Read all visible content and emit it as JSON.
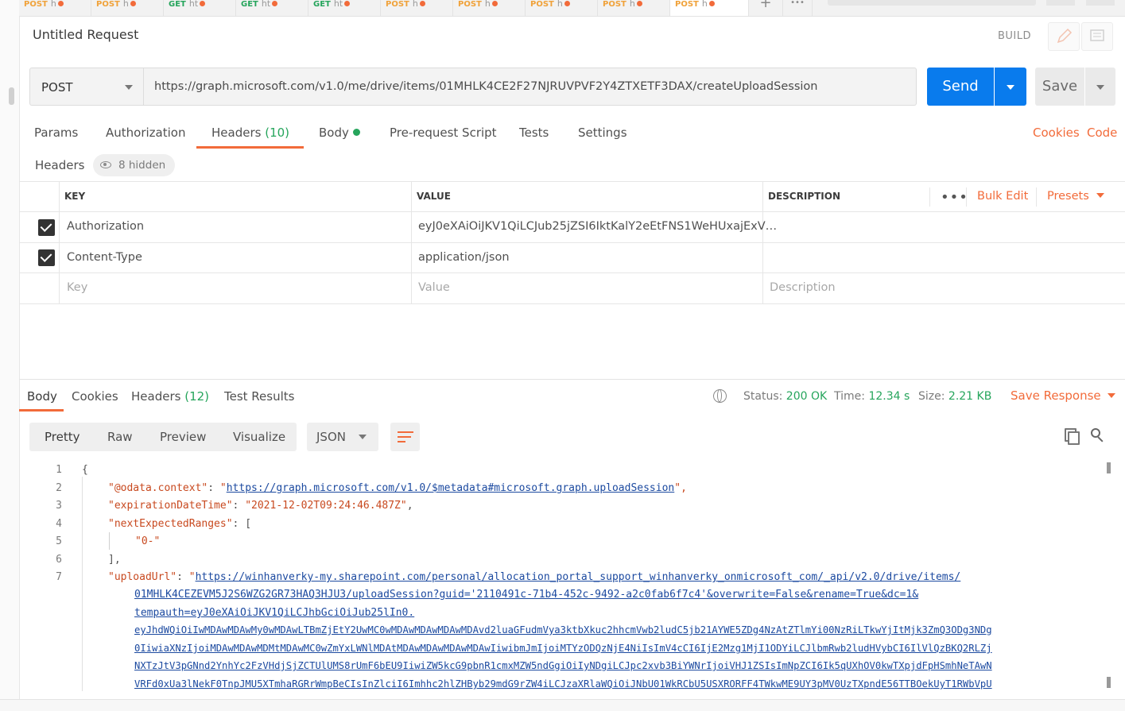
{
  "tabs": [
    {
      "method": "POST",
      "title": "h",
      "color": "#f0a23a"
    },
    {
      "method": "POST",
      "title": "h",
      "color": "#f0a23a"
    },
    {
      "method": "GET",
      "title": "ht",
      "color": "#26a55c"
    },
    {
      "method": "GET",
      "title": "ht",
      "color": "#26a55c"
    },
    {
      "method": "GET",
      "title": "ht",
      "color": "#26a55c"
    },
    {
      "method": "POST",
      "title": "h",
      "color": "#f0a23a"
    },
    {
      "method": "POST",
      "title": "h",
      "color": "#f0a23a"
    },
    {
      "method": "POST",
      "title": "h",
      "color": "#f0a23a"
    },
    {
      "method": "POST",
      "title": "h",
      "color": "#f0a23a"
    },
    {
      "method": "POST",
      "title": "h",
      "color": "#f0a23a"
    }
  ],
  "request": {
    "title": "Untitled Request",
    "build_label": "BUILD",
    "method": "POST",
    "url": "https://graph.microsoft.com/v1.0/me/drive/items/01MHLK4CE2F27NJRUVPVF2Y4ZTXETF3DAX/createUploadSession",
    "send_label": "Send",
    "save_label": "Save"
  },
  "request_tabs": {
    "params": "Params",
    "authorization": "Authorization",
    "headers": "Headers",
    "headers_count": "(10)",
    "body": "Body",
    "prerequest": "Pre-request Script",
    "tests": "Tests",
    "settings": "Settings",
    "cookies": "Cookies",
    "code": "Code"
  },
  "headers_section": {
    "label": "Headers",
    "hidden": "8 hidden",
    "col_key": "KEY",
    "col_value": "VALUE",
    "col_description": "DESCRIPTION",
    "more": "•••",
    "bulk_edit": "Bulk Edit",
    "presets": "Presets",
    "rows": [
      {
        "key": "Authorization",
        "value": "eyJ0eXAiOiJKV1QiLCJub25jZSI6IktKalY2eEtFNS1WeHUxajExV…"
      },
      {
        "key": "Content-Type",
        "value": "application/json"
      }
    ],
    "placeholder_key": "Key",
    "placeholder_value": "Value",
    "placeholder_description": "Description"
  },
  "response": {
    "tab_body": "Body",
    "tab_cookies": "Cookies",
    "tab_headers": "Headers",
    "headers_count": "(12)",
    "tab_tests": "Test Results",
    "status_label": "Status:",
    "status_value": "200 OK",
    "time_label": "Time:",
    "time_value": "12.34 s",
    "size_label": "Size:",
    "size_value": "2.21 KB",
    "save_response": "Save Response"
  },
  "view": {
    "pretty": "Pretty",
    "raw": "Raw",
    "preview": "Preview",
    "visualize": "Visualize",
    "format": "JSON"
  },
  "code": {
    "line_numbers": [
      "1",
      "2",
      "3",
      "4",
      "5",
      "6",
      "7"
    ],
    "l1": "{",
    "l2_key": "\"@odata.context\"",
    "l2_colon": ": ",
    "l2_q1": "\"",
    "l2_url": "https://graph.microsoft.com/v1.0/$metadata#microsoft.graph.uploadSession",
    "l2_end": "\",",
    "l3_key": "\"expirationDateTime\"",
    "l3_val": "\"2021-12-02T09:24:46.487Z\"",
    "l4_key": "\"nextExpectedRanges\"",
    "l4_end": ": [",
    "l5": "\"0-\"",
    "l6": "],",
    "l7_key": "\"uploadUrl\"",
    "l7_q": "\"",
    "upload_url_lines": [
      "https://winhanverky-my.sharepoint.com/personal/allocation_portal_support_winhanverky_onmicrosoft_com/_api/v2.0/drive/items/",
      "01MHLK4CEZEVM5J2S6WZG2GR73HAQ3HJU3/uploadSession?guid='2110491c-71b4-452c-9492-a2c0fab6f7c4'&overwrite=False&rename=True&dc=1&",
      "tempauth=eyJ0eXAiOiJKV1QiLCJhbGciOiJub25lIn0.",
      "eyJhdWQiOiIwMDAwMDAwMy0wMDAwLTBmZjEtY2UwMC0wMDAwMDAwMDAwMDAvd2luaGFudmVya3ktbXkuc2hhcmVwb2ludC5jb21AYWE5ZDg4NzAtZTlmYi00NzRiLTkwYjItMjk3ZmQ3ODg3NDg",
      "0IiwiaXNzIjoiMDAwMDAwMDMtMDAwMC0wZmYxLWNlMDAtMDAwMDAwMDAwMDAwIiwibmJmIjoiMTYzODQzNjE4NiIsImV4cCI6IjE2Mzg1MjI1ODYiLCJlbmRwb2ludHVybCI6IlVlQzBKQ2RLZj",
      "NXTzJtV3pGNnd2YnhYc2FzVHdjSjZCTUlUMS8rUmF6bEU9IiwiZW5kcG9pbnR1cmxMZW5ndGgiOiIyNDgiLCJpc2xvb3BiYWNrIjoiVHJ1ZSIsImNpZCI6Ik5qUXhOV0kwTXpjdFpHSmhNeTAwN",
      "VRFd0xUa3lNekF0TnpJMU5XTmhaRGRrWmpBeCIsInZlciI6Imhhc2hlZHByb29mdG9rZW4iLCJzaXRlaWQiOiJNbU01WkRCbU5USXRORFF4TWkwME9UY3pMV0UzTXpndE56TTBOekUyT1RWbVpU"
    ]
  }
}
